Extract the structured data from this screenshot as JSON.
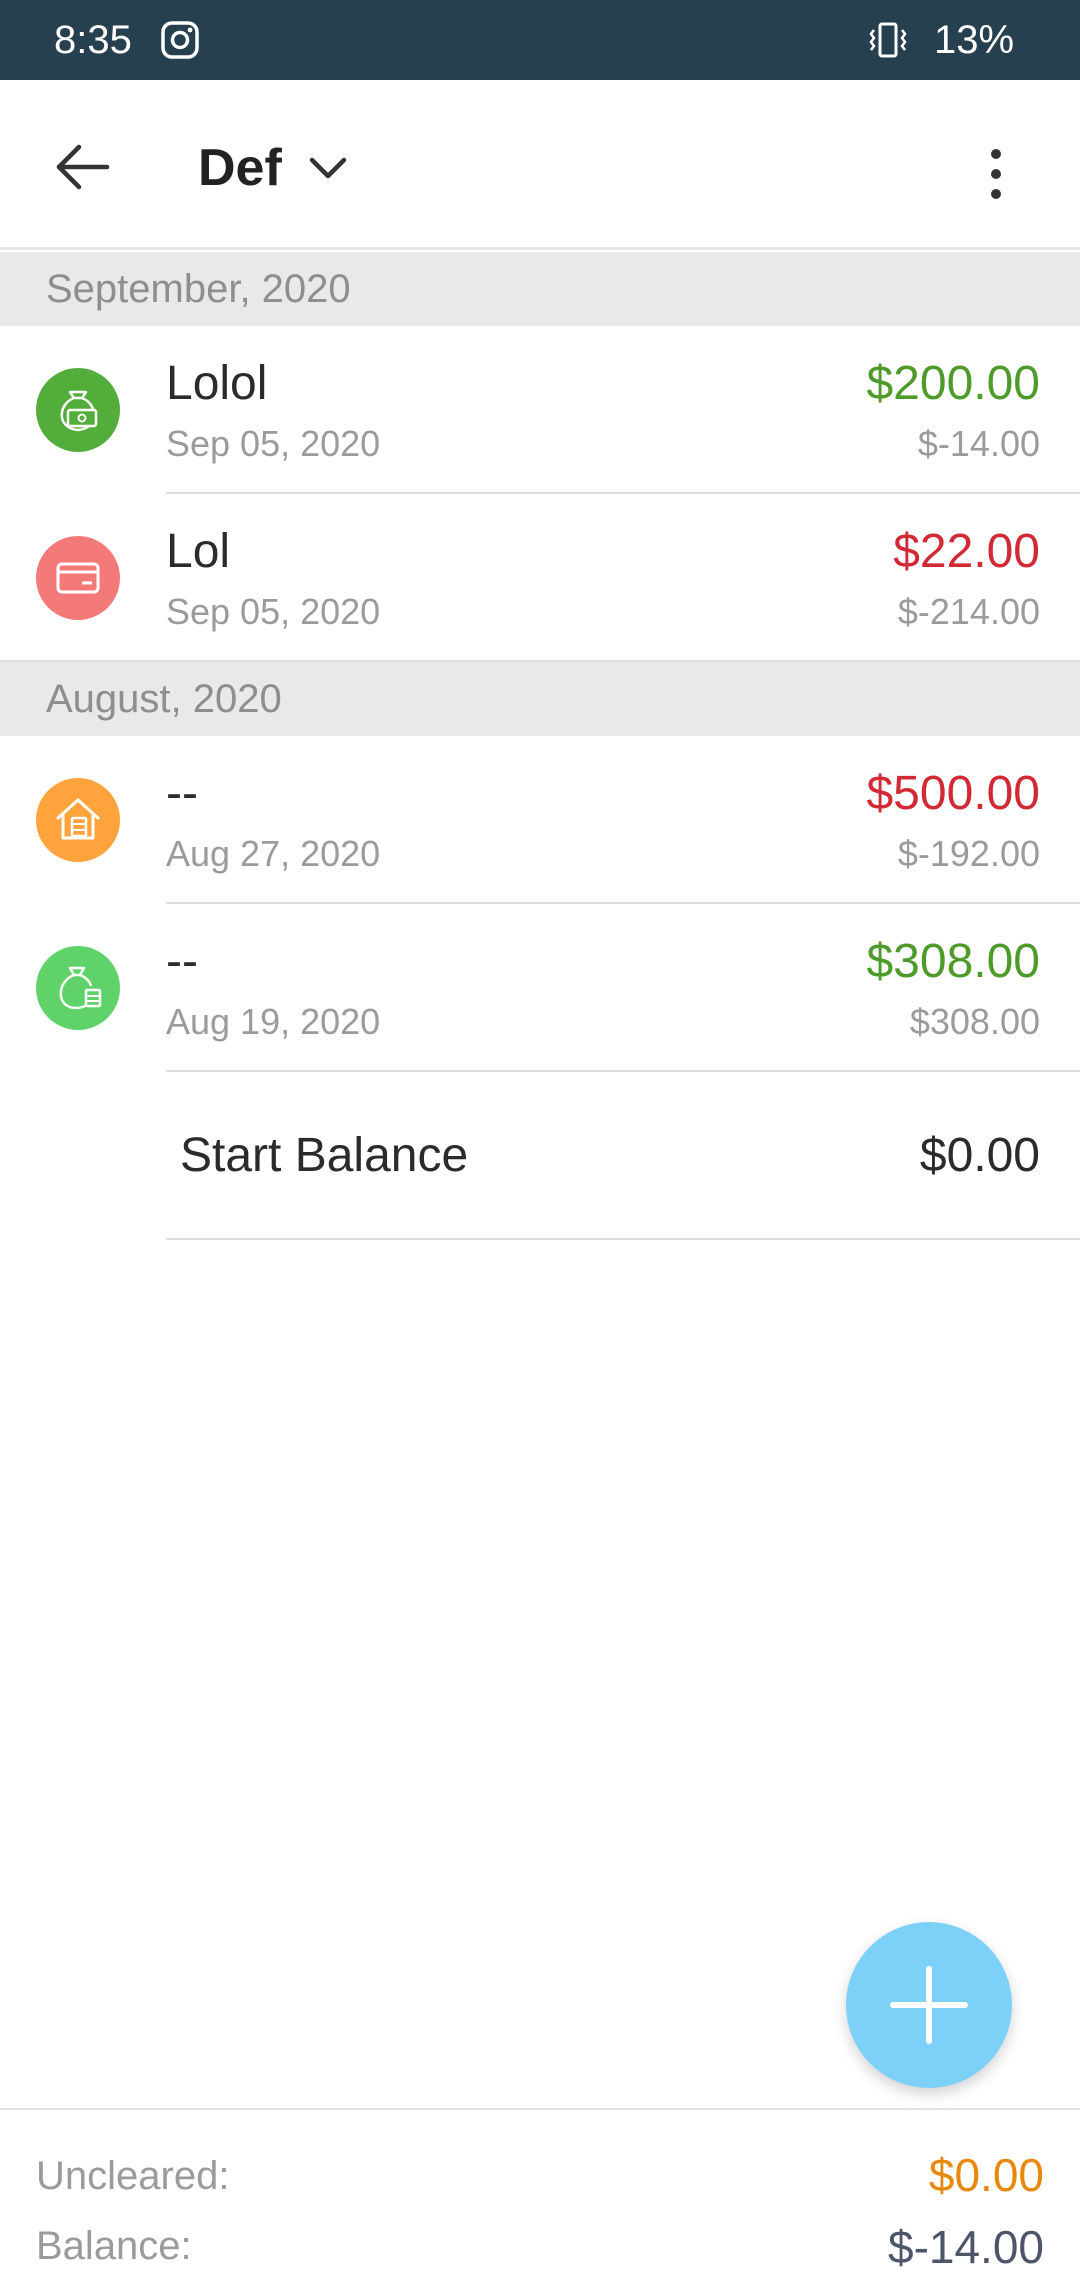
{
  "status_bar": {
    "time": "8:35",
    "battery": "13%",
    "icons": [
      "instagram-icon",
      "vibrate-icon"
    ]
  },
  "app_bar": {
    "title": "Def",
    "icons": [
      "back-arrow-icon",
      "chevron-down-icon",
      "more-vert-icon"
    ]
  },
  "sections": [
    {
      "header": "September, 2020",
      "transactions": [
        {
          "name": "Lolol",
          "date": "Sep 05, 2020",
          "amount": "$200.00",
          "running_balance": "$-14.00",
          "type": "income",
          "icon": "money-bag-cash-icon",
          "icon_color": "#53ad3b"
        },
        {
          "name": "Lol",
          "date": "Sep 05, 2020",
          "amount": "$22.00",
          "running_balance": "$-214.00",
          "type": "expense",
          "icon": "credit-card-icon",
          "icon_color": "#f47a7a"
        }
      ]
    },
    {
      "header": "August, 2020",
      "transactions": [
        {
          "name": "--",
          "date": "Aug 27, 2020",
          "amount": "$500.00",
          "running_balance": "$-192.00",
          "type": "expense",
          "icon": "house-coins-icon",
          "icon_color": "#ffa43d"
        },
        {
          "name": "--",
          "date": "Aug 19, 2020",
          "amount": "$308.00",
          "running_balance": "$308.00",
          "type": "income",
          "icon": "money-bag-coins-icon",
          "icon_color": "#5fd36a"
        }
      ]
    }
  ],
  "start_balance": {
    "label": "Start Balance",
    "value": "$0.00"
  },
  "fab": {
    "icon": "plus-icon",
    "color": "#7dd0f7"
  },
  "footer": {
    "uncleared_label": "Uncleared:",
    "uncleared_value": "$0.00",
    "balance_label": "Balance:",
    "balance_value": "$-14.00"
  },
  "colors": {
    "status_bar": "#27404f",
    "income": "#4e9b2a",
    "expense": "#d22a35",
    "uncleared": "#e8880f"
  }
}
